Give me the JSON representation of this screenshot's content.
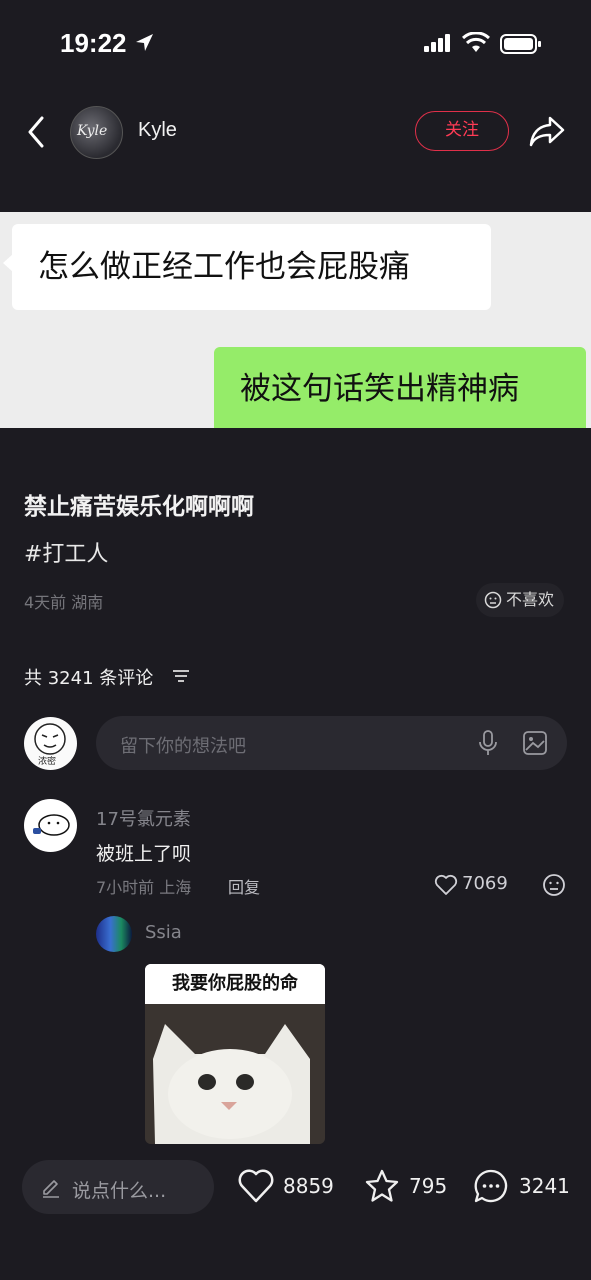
{
  "status_bar": {
    "time": "19:22"
  },
  "header": {
    "author_name": "Kyle",
    "avatar_text": "Kyle",
    "follow_label": "关注"
  },
  "post_image": {
    "left_bubble": "怎么做正经工作也会屁股痛",
    "right_bubble": "被这句话笑出精神病",
    "colors": {
      "background": "#ededed",
      "left_bubble": "#ffffff",
      "right_bubble": "#95ec69"
    }
  },
  "post": {
    "title": "禁止痛苦娱乐化啊啊啊",
    "tag": "#打工人",
    "meta": "4天前 湖南",
    "dislike_label": "不喜欢"
  },
  "comments_section": {
    "count_label": "共 3241 条评论",
    "my_avatar_tag": "浓密",
    "input_placeholder": "留下你的想法吧"
  },
  "comment": {
    "user": "17号氯元素",
    "text": "被班上了呗",
    "meta": "7小时前 上海",
    "reply_label": "回复",
    "likes": "7069"
  },
  "reply": {
    "user": "Ssia",
    "sticker_caption": "我要你屁股的命"
  },
  "bottom_bar": {
    "say_placeholder": "说点什么...",
    "likes": "8859",
    "stars": "795",
    "comments": "3241"
  },
  "colors": {
    "accent": "#ff3b55",
    "background": "#1c1b21"
  }
}
